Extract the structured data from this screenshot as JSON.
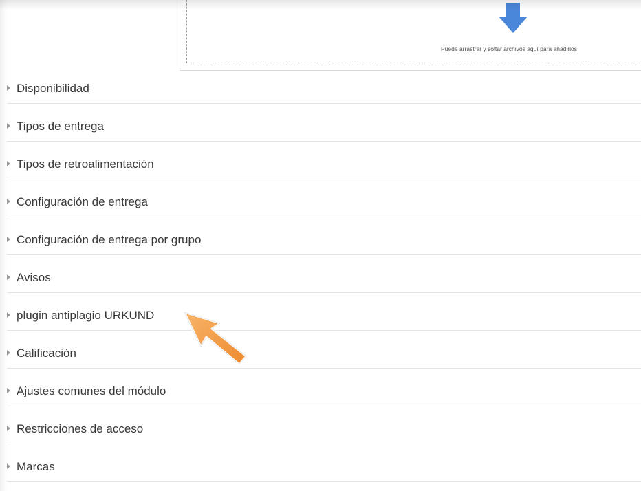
{
  "dropzone": {
    "hint": "Puede arrastrar y soltar archivos aquí para añadirlos",
    "icon": "upload-arrow-icon"
  },
  "sections": [
    {
      "label": "Disponibilidad"
    },
    {
      "label": "Tipos de entrega"
    },
    {
      "label": "Tipos de retroalimentación"
    },
    {
      "label": "Configuración de entrega"
    },
    {
      "label": "Configuración de entrega por grupo"
    },
    {
      "label": "Avisos"
    },
    {
      "label": "plugin antiplagio URKUND"
    },
    {
      "label": "Calificación"
    },
    {
      "label": "Ajustes comunes del módulo"
    },
    {
      "label": "Restricciones de acceso"
    },
    {
      "label": "Marcas"
    }
  ],
  "colors": {
    "upload_arrow": "#4a86d9",
    "pointer_arrow": "#f0913a",
    "text": "#3a3a3a",
    "caret": "#9a9a9a"
  },
  "annotation": {
    "icon": "pointer-arrow-icon",
    "target": "plugin antiplagio URKUND"
  }
}
